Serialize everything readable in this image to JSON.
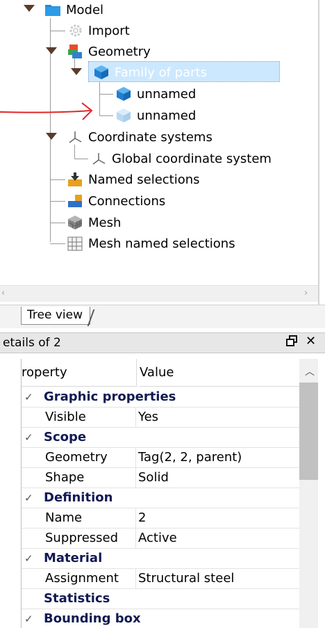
{
  "tree": {
    "items": [
      {
        "id": "model",
        "label": "Model"
      },
      {
        "id": "import",
        "label": "Import"
      },
      {
        "id": "geometry",
        "label": "Geometry"
      },
      {
        "id": "family",
        "label": "Family of parts"
      },
      {
        "id": "part1",
        "label": "unnamed"
      },
      {
        "id": "part2",
        "label": "unnamed"
      },
      {
        "id": "coord",
        "label": "Coordinate systems"
      },
      {
        "id": "global",
        "label": "Global coordinate system"
      },
      {
        "id": "named",
        "label": "Named selections"
      },
      {
        "id": "connections",
        "label": "Connections"
      },
      {
        "id": "mesh",
        "label": "Mesh"
      },
      {
        "id": "meshnamed",
        "label": "Mesh named selections"
      }
    ]
  },
  "tabs": {
    "tree_view": "Tree view"
  },
  "details": {
    "title": "etails of 2",
    "header": {
      "property": "roperty",
      "value": "Value"
    },
    "rows": [
      {
        "type": "category",
        "label": "Graphic properties"
      },
      {
        "type": "prop",
        "label": "Visible",
        "value": "Yes"
      },
      {
        "type": "category",
        "label": "Scope"
      },
      {
        "type": "prop",
        "label": "Geometry",
        "value": "Tag(2, 2, parent)"
      },
      {
        "type": "prop",
        "label": "Shape",
        "value": "Solid"
      },
      {
        "type": "category",
        "label": "Definition"
      },
      {
        "type": "prop",
        "label": "Name",
        "value": "2"
      },
      {
        "type": "prop",
        "label": "Suppressed",
        "value": "Active"
      },
      {
        "type": "category",
        "label": "Material"
      },
      {
        "type": "prop",
        "label": "Assignment",
        "value": "Structural steel"
      },
      {
        "type": "category",
        "label": "Statistics"
      },
      {
        "type": "category",
        "label": "Bounding box"
      }
    ]
  },
  "icons": {
    "model": "folder-icon",
    "import": "gear-icon",
    "geometry": "geometry-stack-icon",
    "part": "cube-icon",
    "coord": "axes-icon",
    "named": "named-selection-icon",
    "connections": "connection-icon",
    "mesh": "mesh-icon",
    "meshnamed": "mesh-grid-icon",
    "pin": "pin-icon",
    "close": "close-icon"
  },
  "colors": {
    "selection": "#cce8ff",
    "annotation_arrow": "#e0262a",
    "category_text": "#111a52"
  }
}
